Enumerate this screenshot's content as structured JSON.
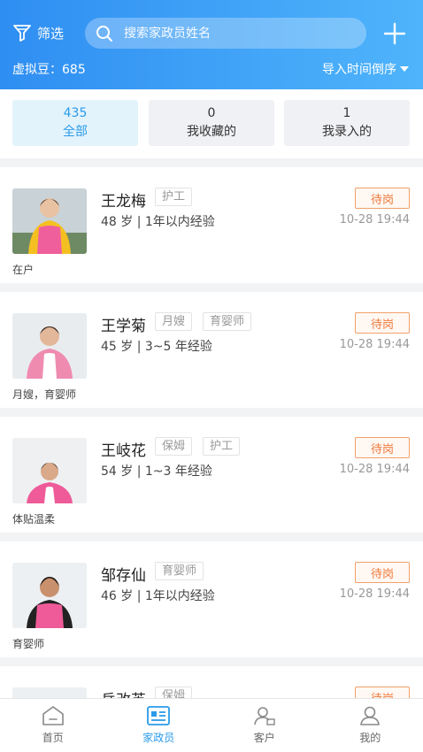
{
  "header": {
    "filter_label": "筛选",
    "search_placeholder": "搜索家政员姓名",
    "beans": "虚拟豆：685",
    "sort_label": "导入时间倒序"
  },
  "tabs": [
    {
      "count": "435",
      "label": "全部"
    },
    {
      "count": "0",
      "label": "我收藏的"
    },
    {
      "count": "1",
      "label": "我录入的"
    }
  ],
  "workers": [
    {
      "name": "王龙梅",
      "tags": [
        "护工"
      ],
      "info": "48 岁 | 1年以内经验",
      "status": "待岗",
      "time": "10-28 19:44",
      "note": "在户"
    },
    {
      "name": "王学菊",
      "tags": [
        "月嫂",
        "育婴师"
      ],
      "info": "45 岁 | 3~5 年经验",
      "status": "待岗",
      "time": "10-28 19:44",
      "note": "月嫂，育婴师"
    },
    {
      "name": "王岐花",
      "tags": [
        "保姆",
        "护工"
      ],
      "info": "54 岁 | 1~3 年经验",
      "status": "待岗",
      "time": "10-28 19:44",
      "note": "体贴温柔"
    },
    {
      "name": "邹存仙",
      "tags": [
        "育婴师"
      ],
      "info": "46 岁 | 1年以内经验",
      "status": "待岗",
      "time": "10-28 19:44",
      "note": "育婴师"
    },
    {
      "name": "岳改英",
      "tags": [
        "保姆"
      ],
      "info": "",
      "status": "待岗",
      "time": "",
      "note": ""
    }
  ],
  "nav": [
    {
      "label": "首页",
      "icon": "home-icon"
    },
    {
      "label": "家政员",
      "icon": "id-card-icon"
    },
    {
      "label": "客户",
      "icon": "client-icon"
    },
    {
      "label": "我的",
      "icon": "user-icon"
    }
  ],
  "colors": {
    "accent": "#2a9bea",
    "status": "#ee7a3c",
    "header_start": "#2f8ef2",
    "header_end": "#4fb4fb"
  }
}
